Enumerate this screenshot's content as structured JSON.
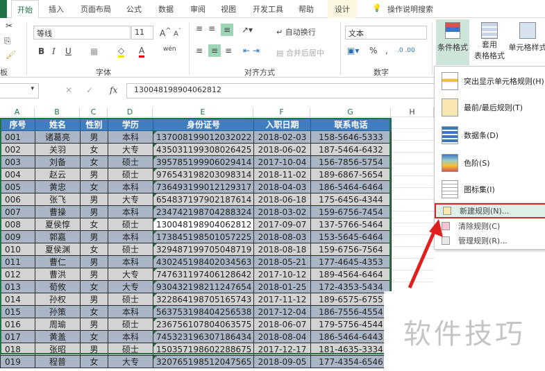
{
  "tabs": [
    "开始",
    "插入",
    "页面布局",
    "公式",
    "数据",
    "审阅",
    "视图",
    "开发工具",
    "帮助",
    "设计",
    "操作说明搜索"
  ],
  "ribbon": {
    "clipboard_label": "板",
    "font_name": "等线",
    "font_size": "11",
    "font_label": "字体",
    "wrap_text": "自动换行",
    "merge_center": "合并后居中",
    "align_label": "对齐方式",
    "number_format": "文本",
    "number_label": "数字",
    "percent": "%",
    "comma": ",",
    "cond_format": "条件格式",
    "table_format_1": "套用",
    "table_format_2": "表格格式",
    "cell_styles": "单元格样式",
    "bold": "B",
    "italic": "I",
    "underline": "U"
  },
  "formula_bar": {
    "fx": "fx",
    "value": "130048198904062812"
  },
  "columns": [
    "A",
    "B",
    "C",
    "D",
    "E",
    "F",
    "G",
    "H"
  ],
  "headers": [
    "序号",
    "姓名",
    "性别",
    "学历",
    "身份证号",
    "入职日期",
    "联系电话"
  ],
  "rows": [
    [
      "001",
      "诸葛亮",
      "男",
      "本科",
      "137008199012032022",
      "2018-02-03",
      "158-5646-5333"
    ],
    [
      "002",
      "关羽",
      "女",
      "大专",
      "435031199308026425",
      "2018-06-02",
      "187-5464-6432"
    ],
    [
      "003",
      "刘备",
      "女",
      "硕士",
      "395785199906029414",
      "2017-10-04",
      "156-7856-5754"
    ],
    [
      "004",
      "赵云",
      "男",
      "硕士",
      "976543198203098314",
      "2018-11-02",
      "189-6867-5654"
    ],
    [
      "005",
      "黄忠",
      "女",
      "本科",
      "736493199012129317",
      "2018-04-03",
      "186-5464-6464"
    ],
    [
      "006",
      "张飞",
      "男",
      "大专",
      "654837197902187614",
      "2018-06-18",
      "175-6456-4344"
    ],
    [
      "007",
      "曹操",
      "男",
      "本科",
      "234742198704288324",
      "2018-03-02",
      "159-6756-7454"
    ],
    [
      "008",
      "夏侯惇",
      "女",
      "硕士",
      "130048198904062812",
      "2017-09-07",
      "137-5766-5464"
    ],
    [
      "009",
      "郭嘉",
      "男",
      "本科",
      "173845198501057225",
      "2018-08-03",
      "153-5645-6464"
    ],
    [
      "010",
      "夏侯渊",
      "女",
      "硕士",
      "329487199705048719",
      "2018-08-18",
      "159-6756-7564"
    ],
    [
      "011",
      "曹仁",
      "男",
      "本科",
      "430245198402034563",
      "2018-05-21",
      "177-4645-4353"
    ],
    [
      "012",
      "曹洪",
      "男",
      "大专",
      "747631197406128642",
      "2017-10-12",
      "189-4564-6464"
    ],
    [
      "013",
      "荀攸",
      "女",
      "大专",
      "930432198211247654",
      "2018-01-25",
      "172-4353-5434"
    ],
    [
      "014",
      "孙权",
      "男",
      "硕士",
      "322864198705165743",
      "2017-11-12",
      "189-6575-6755"
    ],
    [
      "015",
      "孙策",
      "女",
      "本科",
      "563753198404256538",
      "2017-12-04",
      "186-7556-4554"
    ],
    [
      "016",
      "周瑜",
      "男",
      "硕士",
      "236756107804063575",
      "2018-06-07",
      "179-5756-4544"
    ],
    [
      "017",
      "黄盖",
      "女",
      "本科",
      "745323196307186434",
      "2018-08-04",
      "186-5464-6443"
    ],
    [
      "018",
      "张昭",
      "男",
      "硕士",
      "150357198602288675",
      "2017-12-17",
      "181-4635-3334"
    ],
    [
      "019",
      "程普",
      "女",
      "大专",
      "320765198512047565",
      "2018-09-05",
      "177-4354-6546"
    ]
  ],
  "menu": {
    "items": [
      "突出显示单元格规则(H)",
      "最前/最后规则(T)",
      "数据条(D)",
      "色阶(S)",
      "图标集(I)"
    ],
    "small": [
      "新建规则(N)...",
      "清除规则(C)",
      "管理规则(R)..."
    ]
  },
  "watermark": "软件技巧",
  "colors": {
    "accent": "#217346",
    "header": "#3f7fc1",
    "highlight": "#d12a2a"
  }
}
